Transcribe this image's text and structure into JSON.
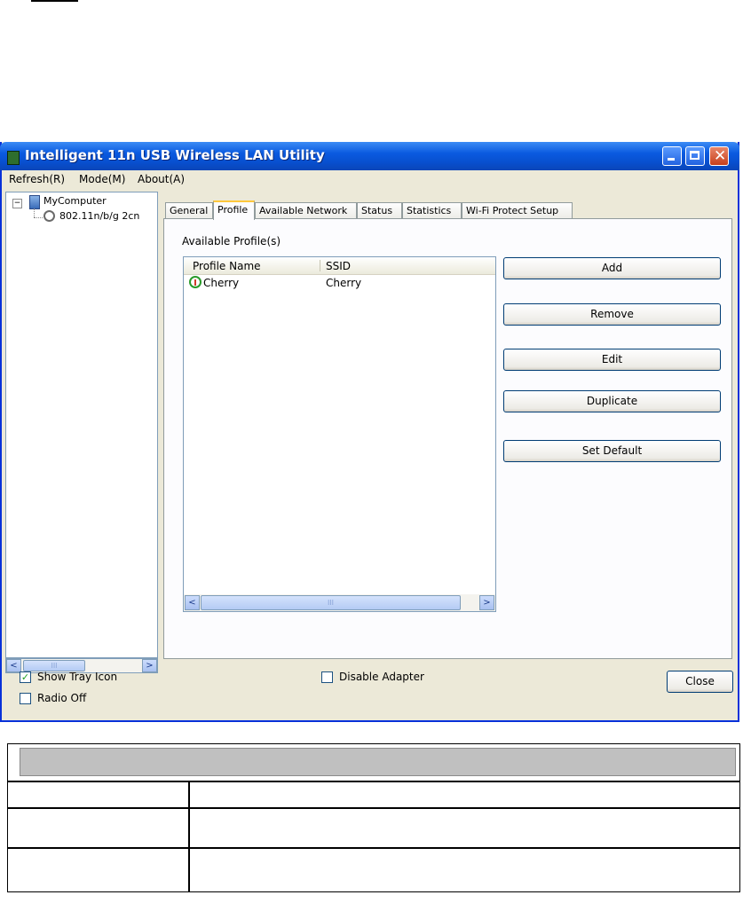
{
  "window": {
    "title": "Intelligent 11n USB Wireless LAN Utility",
    "minimize_glyph": "",
    "maximize_glyph": "",
    "close_glyph": "✕"
  },
  "menu": {
    "items": [
      "Refresh(R)",
      "Mode(M)",
      "About(A)"
    ]
  },
  "tree": {
    "expander": "−",
    "root": "MyComputer",
    "adapter": "802.11n/b/g 2cn",
    "scroll_left": "<",
    "scroll_right": ">",
    "thumb_label": "III"
  },
  "tabs": {
    "items": [
      "General",
      "Profile",
      "Available Network",
      "Status",
      "Statistics",
      "Wi-Fi Protect Setup"
    ],
    "active": "Profile"
  },
  "profile": {
    "section_title": "Available Profile(s)",
    "columns": [
      "Profile Name",
      "SSID"
    ],
    "rows": [
      {
        "profile_name": "Cherry",
        "ssid": "Cherry"
      }
    ],
    "scroll_left": "<",
    "scroll_right": ">",
    "thumb_label": "III",
    "buttons": {
      "add": "Add",
      "remove": "Remove",
      "edit": "Edit",
      "duplicate": "Duplicate",
      "set_default": "Set Default"
    }
  },
  "footer": {
    "show_tray_icon": {
      "label": "Show Tray Icon",
      "checked": true,
      "mark": "✓"
    },
    "radio_off": {
      "label": "Radio Off",
      "checked": false,
      "mark": ""
    },
    "disable_adapter": {
      "label": "Disable Adapter",
      "checked": false,
      "mark": ""
    },
    "close": "Close"
  },
  "colors": {
    "titlebar": "#0a5ae0",
    "window_bg": "#ece9d8",
    "active_tab_accent": "#ffc83c",
    "table_header_gray": "#c0c0c0"
  }
}
